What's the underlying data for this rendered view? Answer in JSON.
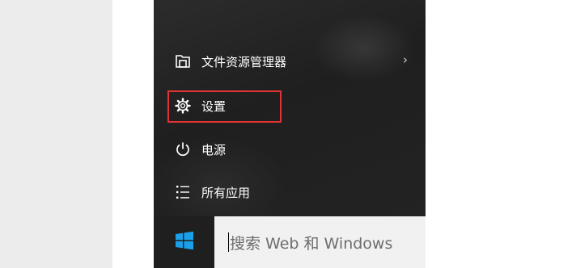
{
  "start_menu": {
    "items": [
      {
        "label": "文件资源管理器",
        "icon": "file-explorer-icon",
        "has_submenu": true,
        "chevron": "›"
      },
      {
        "label": "设置",
        "icon": "gear-icon",
        "highlighted": true
      },
      {
        "label": "电源",
        "icon": "power-icon"
      },
      {
        "label": "所有应用",
        "icon": "all-apps-icon"
      }
    ]
  },
  "taskbar": {
    "start_icon": "windows-logo-icon",
    "search_placeholder": "搜索 Web 和 Windows"
  },
  "colors": {
    "menu_bg": "#262626",
    "highlight_border": "#e03333",
    "windows_logo": "#1aa0e8",
    "search_bg": "#f1f1f1"
  }
}
